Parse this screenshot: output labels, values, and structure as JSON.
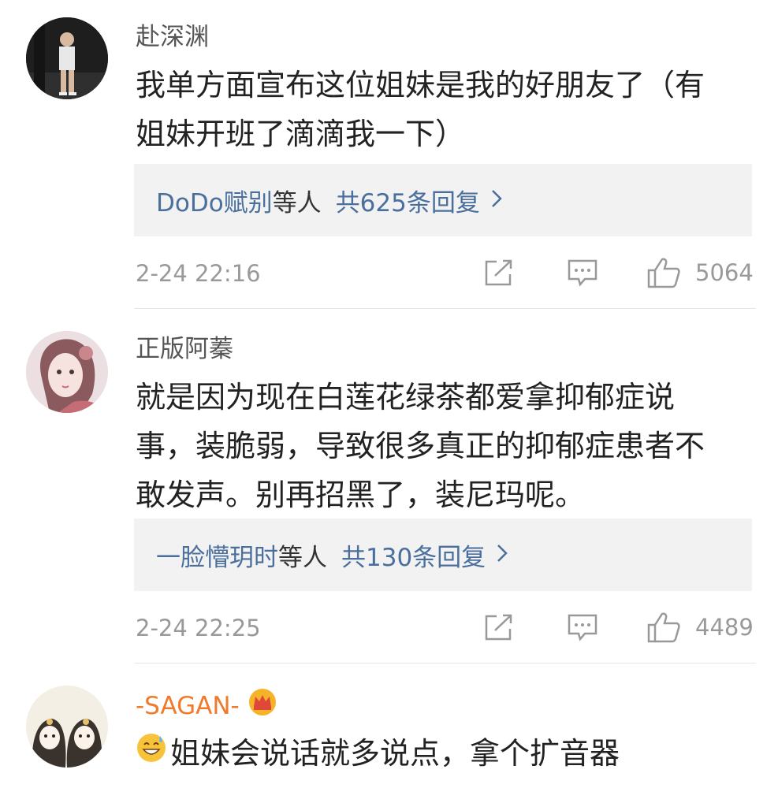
{
  "comments": [
    {
      "username": "赴深渊",
      "text": "我单方面宣布这位姐妹是我的好朋友了（有\n姐妹开班了滴滴我一下）",
      "reply": {
        "names": "DoDo赋别",
        "suffix": "等人",
        "count_label": "共625条回复"
      },
      "time": "2-24 22:16",
      "likes": "5064"
    },
    {
      "username": "正版阿蓁",
      "text": "就是因为现在白莲花绿茶都爱拿抑郁症说\n事，装脆弱，导致很多真正的抑郁症患者不\n敢发声。别再招黑了，装尼玛呢。",
      "reply": {
        "names": "一脸懵玥时",
        "suffix": "等人",
        "count_label": "共130条回复"
      },
      "time": "2-24 22:25",
      "likes": "4489"
    },
    {
      "username": "-SAGAN-",
      "badge_icon": "crown-badge-icon",
      "emoji_icon": "grinning-sweat-emoji-icon",
      "text": "姐妹会说话就多说点，拿个扩音器"
    }
  ],
  "icons": {
    "share": "share-icon",
    "reply": "comment-icon",
    "like": "thumbs-up-icon",
    "chevron": "chevron-right-icon"
  },
  "colors": {
    "link": "#4a6f9d",
    "vip_name": "#f07a2a",
    "muted": "#999999",
    "reply_bg": "#f2f2f2"
  }
}
